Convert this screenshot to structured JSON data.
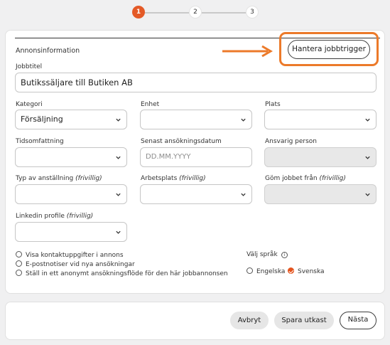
{
  "stepper": {
    "steps": [
      "1",
      "2",
      "3"
    ],
    "active_step": 1
  },
  "form": {
    "section_title": "Annonsinformation",
    "hantera_button": "Hantera jobbtrigger",
    "jobbtitel": {
      "label": "Jobbtitel",
      "value": "Butikssäljare till Butiken AB"
    },
    "kategori": {
      "label": "Kategori",
      "value": "Försäljning"
    },
    "enhet": {
      "label": "Enhet",
      "value": ""
    },
    "plats": {
      "label": "Plats",
      "value": ""
    },
    "tidsomfattning": {
      "label": "Tidsomfattning",
      "value": ""
    },
    "senast": {
      "label": "Senast ansökningsdatum",
      "placeholder": "DD.MM.YYYY"
    },
    "ansvarig": {
      "label": "Ansvarig person",
      "value": ""
    },
    "typ": {
      "label": "Typ av anställning",
      "optional": "(frivillig)",
      "value": ""
    },
    "arbetsplats": {
      "label": "Arbetsplats",
      "optional": "(frivillig)",
      "value": ""
    },
    "gom": {
      "label": "Göm jobbet från",
      "optional": "(frivillig)",
      "value": ""
    },
    "linkedin": {
      "label": "Linkedin profile",
      "optional": "(frivillig)",
      "value": ""
    },
    "options": [
      "Visa kontaktuppgifter i annons",
      "E-postnotiser vid nya ansökningar",
      "Ställ in ett anonymt ansökningsflöde för den här jobbannonsen"
    ],
    "language": {
      "label": "Välj språk",
      "options": [
        "Engelska",
        "Svenska"
      ],
      "selected": "Svenska"
    }
  },
  "footer": {
    "cancel": "Avbryt",
    "save_draft": "Spara utkast",
    "next": "Nästa"
  },
  "colors": {
    "accent": "#e45a27",
    "highlight": "#ec7a2a",
    "disabled": "#e8e8e8"
  }
}
